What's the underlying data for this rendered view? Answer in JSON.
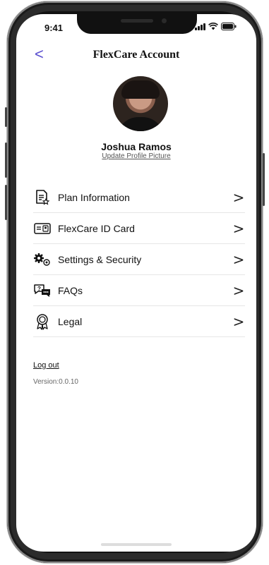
{
  "status_bar": {
    "time": "9:41"
  },
  "nav": {
    "back_glyph": "<",
    "title": "FlexCare Account"
  },
  "profile": {
    "name": "Joshua Ramos",
    "update_picture_label": "Update Profile Picture"
  },
  "menu": {
    "items": [
      {
        "label": "Plan Information",
        "icon": "document-star-icon"
      },
      {
        "label": "FlexCare ID Card",
        "icon": "id-card-icon"
      },
      {
        "label": "Settings & Security",
        "icon": "gears-icon"
      },
      {
        "label": "FAQs",
        "icon": "faq-chat-icon"
      },
      {
        "label": "Legal",
        "icon": "award-ribbon-icon"
      }
    ],
    "chevron_glyph": ">"
  },
  "footer": {
    "logout_label": "Log out",
    "version_text": "Version:0.0.10"
  },
  "colors": {
    "accent": "#5a4fcf",
    "text": "#111111",
    "divider": "#e6e6e6"
  }
}
